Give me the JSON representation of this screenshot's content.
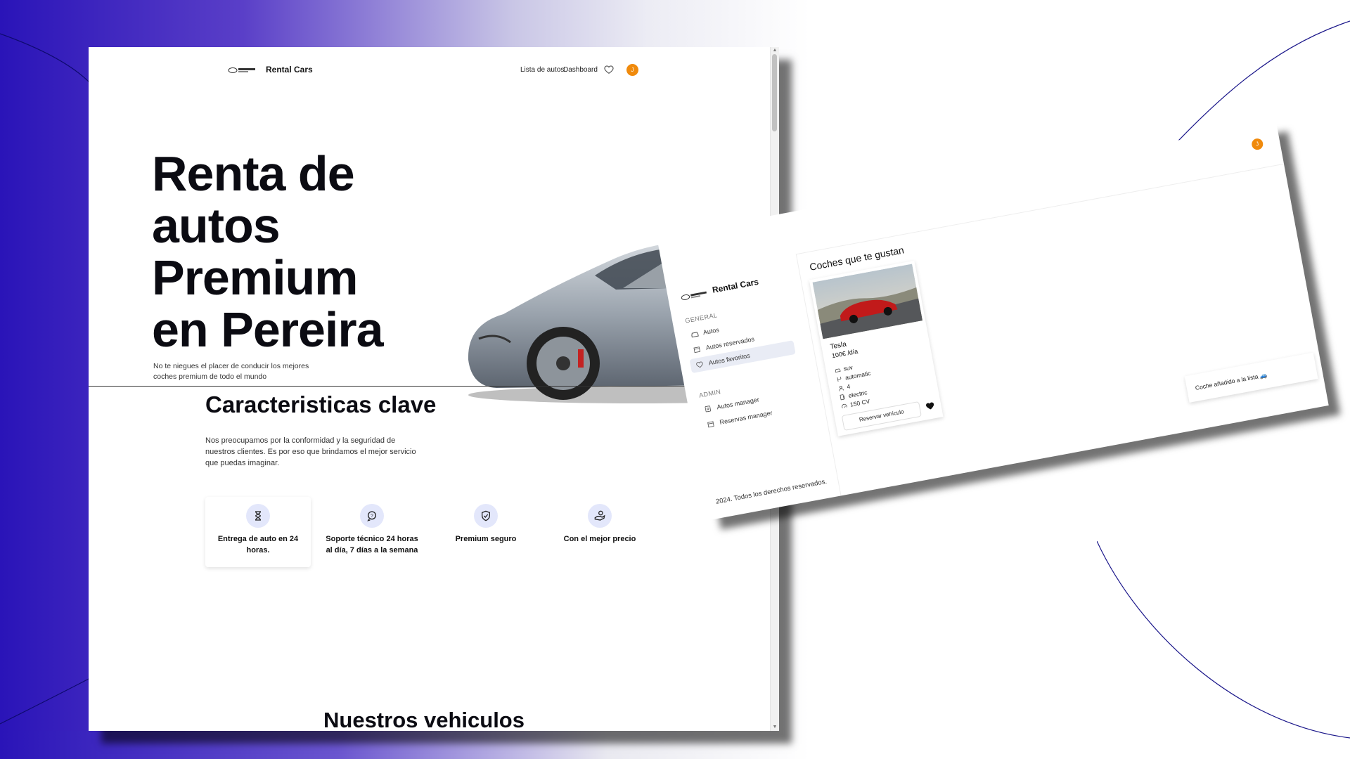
{
  "main_window": {
    "nav": {
      "brand": "Rental Cars",
      "links": [
        "Lista de autos",
        "Dashboard"
      ],
      "avatar_initial": "J"
    },
    "hero": {
      "title_lines": [
        "Renta de",
        "autos",
        "Premium",
        "en Pereira"
      ],
      "subtitle": "No te niegues el placer de conducir los mejores coches premium de todo el mundo"
    },
    "features": {
      "title": "Caracteristicas clave",
      "description": "Nos preocupamos por la conformidad y la seguridad de nuestros clientes. Es por eso que brindamos el mejor servicio que puedas imaginar.",
      "items": [
        {
          "label": "Entrega de auto en 24 horas.",
          "icon": "hourglass-icon"
        },
        {
          "label": "Soporte técnico 24 horas al día, 7 días a la semana",
          "icon": "support-chat-icon"
        },
        {
          "label": "Premium seguro",
          "icon": "shield-check-icon"
        },
        {
          "label": "Con el mejor precio",
          "icon": "price-hand-icon"
        }
      ]
    },
    "vehicles_title": "Nuestros vehiculos"
  },
  "dashboard_window": {
    "brand": "Rental Cars",
    "avatar_initial": "J",
    "sections": [
      {
        "title": "GENERAL",
        "items": [
          {
            "label": "Autos",
            "icon": "car-icon",
            "active": false
          },
          {
            "label": "Autos reservados",
            "icon": "calendar-icon",
            "active": false
          },
          {
            "label": "Autos favoritos",
            "icon": "heart-icon",
            "active": true
          }
        ]
      },
      {
        "title": "ADMIN",
        "items": [
          {
            "label": "Autos manager",
            "icon": "car-manage-icon",
            "active": false
          },
          {
            "label": "Reservas manager",
            "icon": "calendar-icon",
            "active": false
          }
        ]
      }
    ],
    "footer": "2024. Todos los derechos reservados.",
    "heading": "Coches que te gustan",
    "car": {
      "name": "Tesla",
      "price": "100€ /día",
      "specs": [
        {
          "icon": "body-type-icon",
          "value": "suv"
        },
        {
          "icon": "transmission-icon",
          "value": "automatic"
        },
        {
          "icon": "people-icon",
          "value": "4"
        },
        {
          "icon": "fuel-icon",
          "value": "electric"
        },
        {
          "icon": "power-icon",
          "value": "150 CV"
        }
      ],
      "reserve_label": "Reservar vehículo"
    },
    "toast": "Coche añadido a la lista 🚙"
  },
  "colors": {
    "accent_orange": "#f08a0c",
    "bg_blue": "#2a14b8",
    "icon_bg": "#e3e7fb"
  }
}
